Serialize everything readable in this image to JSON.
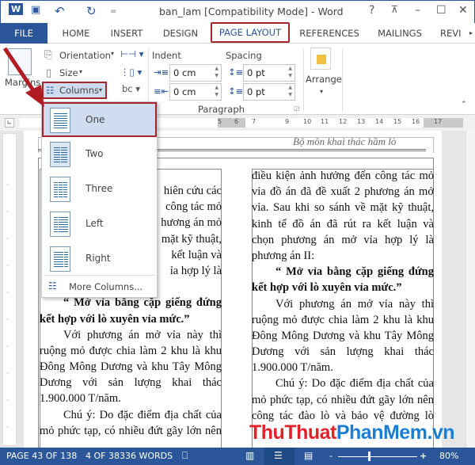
{
  "window": {
    "title": "ban_lam [Compatibility Mode] - Word",
    "help": "?",
    "minimize": "–",
    "maximize": "☐",
    "close": "✕"
  },
  "qat": {
    "word": "W",
    "save": "💾",
    "undo": "↶",
    "redo": "↻",
    "customize": "="
  },
  "tabs": [
    {
      "label": "FILE"
    },
    {
      "label": "HOME"
    },
    {
      "label": "INSERT"
    },
    {
      "label": "DESIGN"
    },
    {
      "label": "PAGE LAYOUT",
      "active": true
    },
    {
      "label": "REFERENCES"
    },
    {
      "label": "MAILINGS"
    },
    {
      "label": "REVI"
    }
  ],
  "ribbon": {
    "margins": "Margins",
    "orientation": "Orientation",
    "size": "Size",
    "columns": "Columns",
    "indent_label": "Indent",
    "spacing_label": "Spacing",
    "indent_left": "0 cm",
    "indent_right": "0 cm",
    "spacing_before": "0 pt",
    "spacing_after": "0 pt",
    "paragraph_group": "Paragraph",
    "arrange": "Arrange"
  },
  "columns_menu": {
    "items": [
      {
        "label": "One",
        "state": "hovered"
      },
      {
        "label": "Two",
        "state": "current"
      },
      {
        "label": "Three"
      },
      {
        "label": "Left"
      },
      {
        "label": "Right"
      }
    ],
    "more": "More Columns..."
  },
  "ruler": {
    "ticks": [
      "5",
      "6",
      "7",
      "9",
      "10",
      "11",
      "12",
      "13",
      "14",
      "15",
      "16",
      "17"
    ]
  },
  "document": {
    "header": "Bộ môn khai thác hầm lò",
    "left_column": [
      {
        "t": "hiên cứu các",
        "c": "r"
      },
      {
        "t": "công tác mỏ",
        "c": "r"
      },
      {
        "t": "hương án mỏ",
        "c": "r"
      },
      {
        "t": "mặt kỹ thuật,",
        "c": "r"
      },
      {
        "t": "kết luận và",
        "c": "r"
      },
      {
        "t": "ỉa hợp lý là",
        "c": "r"
      },
      {
        "t": "",
        "c": "last"
      },
      {
        "t": "“ Mở vỉa bằng cặp giếng đứng",
        "c": "ind b"
      },
      {
        "t": "kết hợp với lò xuyên vỉa mức.”",
        "c": "b last"
      },
      {
        "t": "Với phương án mở vỉa này thì",
        "c": "ind"
      },
      {
        "t": "ruộng mỏ được chia làm 2 khu là khu",
        "c": ""
      },
      {
        "t": "Đông Mông Dương và khu Tây Mông",
        "c": ""
      },
      {
        "t": "Dương với sản lượng khai thác",
        "c": ""
      },
      {
        "t": "1.900.000 T/năm.",
        "c": "last"
      },
      {
        "t": "Chú ý: Do đặc điểm địa chất của",
        "c": "ind"
      },
      {
        "t": "mỏ phức tạp, có nhiều đứt gãy lớn nên",
        "c": ""
      }
    ],
    "right_column": [
      {
        "t": "điều kiện ảnh hưởng đến công tác mỏ",
        "c": ""
      },
      {
        "t": "vỉa đồ án đã đề xuất 2 phương án mở",
        "c": ""
      },
      {
        "t": "vỉa. Sau khi so sánh về mặt kỹ thuật,",
        "c": ""
      },
      {
        "t": "kinh tế đồ án đã rút ra kết luận và",
        "c": ""
      },
      {
        "t": "chọn phương án mở vỉa hợp lý là",
        "c": ""
      },
      {
        "t": "phương án II:",
        "c": "last"
      },
      {
        "t": "“ Mở vỉa bằng cặp giếng đứng",
        "c": "ind b"
      },
      {
        "t": "kết hợp với lò xuyên vỉa mức.”",
        "c": "b last"
      },
      {
        "t": "Với phương án mở vỉa này thì",
        "c": "ind"
      },
      {
        "t": "ruộng mỏ được chia làm 2 khu là khu",
        "c": ""
      },
      {
        "t": "Đông Mông Dương và khu Tây Mông",
        "c": ""
      },
      {
        "t": "Dương với sản lượng khai thác",
        "c": ""
      },
      {
        "t": "1.900.000 T/năm.",
        "c": "last"
      },
      {
        "t": "Chú ý: Do đặc điểm địa chất của",
        "c": "ind"
      },
      {
        "t": "mỏ phức tạp, có nhiều đứt gãy lớn nên",
        "c": ""
      },
      {
        "t": "công tác đào lò và bảo vệ đường lò",
        "c": ""
      }
    ]
  },
  "watermark": {
    "part1": "ThuThuat",
    "part2": "PhanMem.vn",
    "color1": "#e2222b",
    "color2": "#1a7fd4"
  },
  "status": {
    "page": "PAGE 43 OF 138",
    "words": "4 OF 38336 WORDS",
    "zoom_minus": "-",
    "zoom_plus": "+",
    "zoom": "80%",
    "zoom_percent": 80
  },
  "colors": {
    "accent": "#2b579a",
    "highlight": "#a4262c"
  }
}
